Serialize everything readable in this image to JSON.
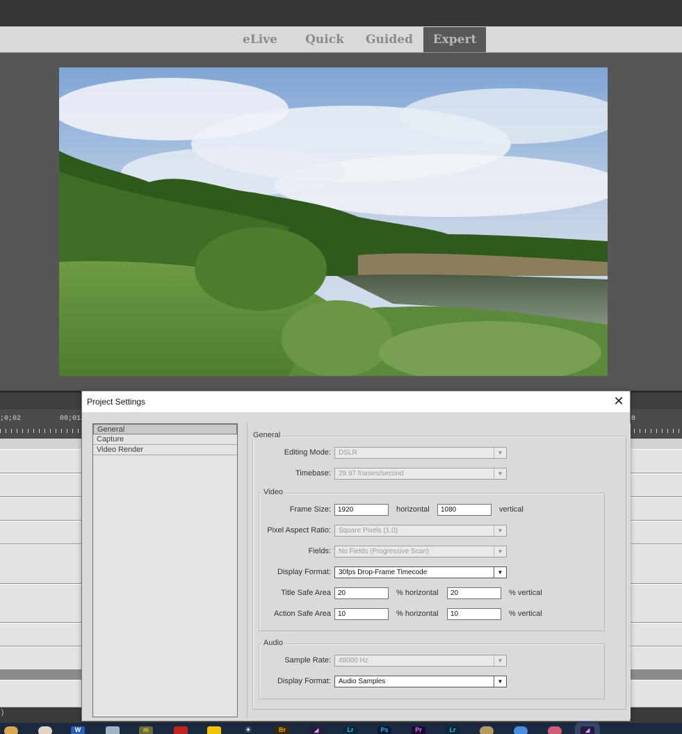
{
  "modes": [
    {
      "label": "eLive",
      "active": false
    },
    {
      "label": "Quick",
      "active": false
    },
    {
      "label": "Guided",
      "active": false
    },
    {
      "label": "Expert",
      "active": true
    }
  ],
  "timeline": {
    "ruler_left": ";0;02",
    "ruler_mid": "00;01;",
    "ruler_right": "8",
    "status": ")"
  },
  "dialog": {
    "title": "Project Settings",
    "close_symbol": "✕",
    "nav": [
      "General",
      "Capture",
      "Video Render"
    ],
    "general": {
      "group_label": "General",
      "editing_mode_label": "Editing Mode:",
      "editing_mode_value": "DSLR",
      "timebase_label": "Timebase:",
      "timebase_value": "29.97 frames/second"
    },
    "video": {
      "group_label": "Video",
      "frame_size_label": "Frame Size:",
      "frame_width": "1920",
      "horizontal_unit": "horizontal",
      "frame_height": "1080",
      "vertical_unit": "vertical",
      "pixel_aspect_label": "Pixel Aspect Ratio:",
      "pixel_aspect_value": "Square Pixels (1.0)",
      "fields_label": "Fields:",
      "fields_value": "No Fields (Progressive Scan)",
      "display_format_label": "Display Format:",
      "display_format_value": "30fps Drop-Frame Timecode",
      "title_safe_label": "Title Safe Area",
      "title_safe_h": "20",
      "title_safe_v": "20",
      "action_safe_label": "Action Safe Area",
      "action_safe_h": "10",
      "action_safe_v": "10",
      "pct_horizontal": "% horizontal",
      "pct_vertical": "% vertical"
    },
    "audio": {
      "group_label": "Audio",
      "sample_rate_label": "Sample Rate:",
      "sample_rate_value": "48000 Hz",
      "display_format_label": "Display Format:",
      "display_format_value": "Audio Samples"
    }
  },
  "colors": {
    "accent_active_tab": "#585858",
    "dialog_body": "#dadada",
    "taskbar": "#1a2a42"
  },
  "icons": {
    "dropdown": "chevron-down-icon",
    "close": "close-icon"
  },
  "taskbar_icons": [
    "chrome-icon",
    "paint-icon",
    "word-icon",
    "folder-icon",
    "mc-icon",
    "adobe-red-icon",
    "norton-icon",
    "sun-icon",
    "bridge-icon",
    "premiere-elements-icon",
    "lightroom-icon",
    "photoshop-icon",
    "premiere-icon",
    "lightroom-classic-icon",
    "paint-palette-icon",
    "globe-icon",
    "browser-icon",
    "premiere-elements-active-icon"
  ]
}
